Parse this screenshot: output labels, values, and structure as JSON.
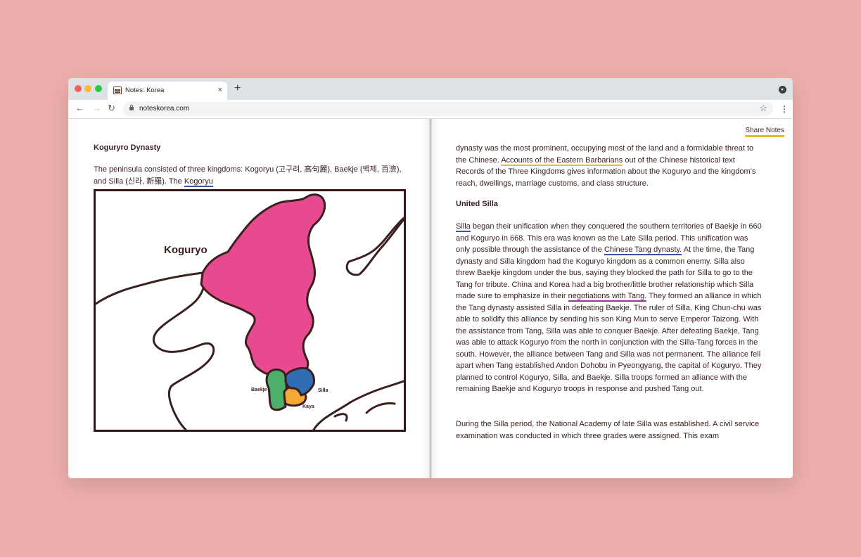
{
  "browser": {
    "tab_title": "Notes: Korea",
    "tab_close": "×",
    "new_tab": "+",
    "url": "noteskorea.com",
    "back": "←",
    "forward": "→",
    "reload": "↻",
    "bookmark": "☆",
    "menu": "⋮"
  },
  "share_label": "Share Notes",
  "left_page": {
    "heading": "Koguryro Dynasty",
    "para_text": "The peninsula consisted of three kingdoms: Kogoryu (고구려, 高句麗), Baekje (백제, 百濟), and Silla (신라, 新羅). The ",
    "para_link": "Kogoryu",
    "map": {
      "label_koguryo": "Koguryo",
      "label_baekje": "Baekje",
      "label_silla": "Silla",
      "label_kaya": "Kaya",
      "colors": {
        "koguryo": "#e84a8f",
        "baekje": "#4caf6a",
        "silla": "#2f6db5",
        "kaya": "#f3a936",
        "outline": "#3a1f1f"
      }
    }
  },
  "right_page": {
    "para1": {
      "t1": "dynasty was the most prominent, occupying most of the land and a formidable threat to the Chinese. ",
      "hl1": "Accounts of the Eastern Barbarians",
      "t2": " out of the Chinese historical text Records of the Three Kingdoms gives information about the Koguryo and the kingdom’s reach, dwellings, marriage customs, and class structure."
    },
    "heading": "United Silla",
    "para2": {
      "hl1": "Silla",
      "t1": " began their unification when they conquered the southern territories of Baekje in 660 and Koguryo in 668. This era was known as the Late Silla period. This unification was only possible through the assistance of the ",
      "hl2": "Chinese Tang dynasty.",
      "t2": " At the time, the Tang dynasty and Silla kingdom had the Koguryo kingdom as a common enemy. Silla also threw Baekje kingdom under the bus, saying they blocked the path for Silla to go to the Tang for tribute. China and Korea had a big brother/little brother relationship which Silla made sure to emphasize in their ",
      "hl3": "negotiations with Tang.",
      "t3": " They formed an alliance in which the Tang dynasty assisted Silla in defeating Baekje. The ruler of Silla, King Chun-chu was able to solidify this alliance by sending his son King Mun to serve Emperor Taizong. With the assistance from Tang, Silla was able to conquer Baekje. After defeating Baekje, Tang was able to attack Koguryo from the north in conjunction with the Silla-Tang forces in the south. However, the alliance between Tang and Silla was not permanent. The alliance fell apart when Tang established Andon Dohobu in Pyeongyang, the capital of Koguryo. They planned to control Koguryo, Silla, and Baekje. Silla troops formed an alliance with the remaining Baekje and Koguryo troops in response and pushed Tang out."
    },
    "para3": "During the Silla period, the National Academy of late Silla was established. A civil service examination was conducted in which three grades were assigned. This exam"
  }
}
